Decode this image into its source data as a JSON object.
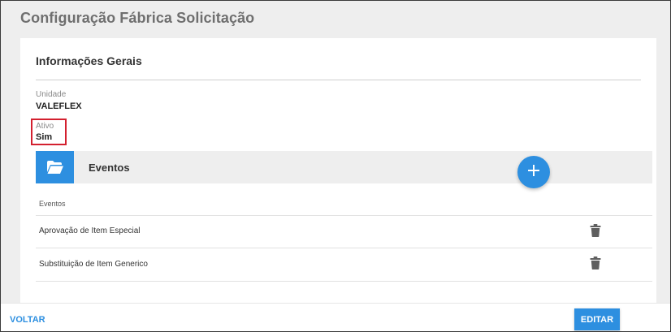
{
  "header": {
    "title": "Configuração Fábrica Solicitação"
  },
  "general": {
    "title": "Informações Gerais",
    "unidade": {
      "label": "Unidade",
      "value": "VALEFLEX"
    },
    "ativo": {
      "label": "Ativo",
      "value": "Sim"
    }
  },
  "eventos": {
    "title": "Eventos",
    "table_header": "Eventos",
    "rows": [
      {
        "label": "Aprovação de Item Especial"
      },
      {
        "label": "Substituição de Item Generico"
      }
    ]
  },
  "icons": {
    "folder": "folder-open-icon",
    "add": "plus-icon",
    "delete": "trash-icon"
  },
  "colors": {
    "accent": "#2d8fe0",
    "highlight": "#d3202f"
  },
  "footer": {
    "back_label": "VOLTAR",
    "edit_label": "EDITAR"
  }
}
